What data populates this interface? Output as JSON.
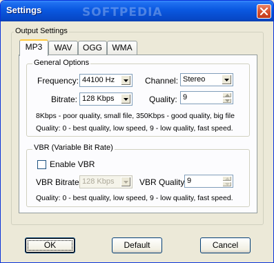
{
  "window": {
    "title": "Settings",
    "watermark": "SOFTPEDIA"
  },
  "output_settings": {
    "label": "Output Settings",
    "tabs": [
      {
        "label": "MP3",
        "active": true
      },
      {
        "label": "WAV",
        "active": false
      },
      {
        "label": "OGG",
        "active": false
      },
      {
        "label": "WMA",
        "active": false
      }
    ]
  },
  "general_options": {
    "label": "General Options",
    "frequency_label": "Frequency:",
    "frequency_value": "44100 Hz",
    "channel_label": "Channel:",
    "channel_value": "Stereo",
    "bitrate_label": "Bitrate:",
    "bitrate_value": "128 Kbps",
    "quality_label": "Quality:",
    "quality_value": "9",
    "hint_bitrate": "8Kbps - poor quality, small file, 350Kbps - good quality, big file",
    "hint_quality": "Quality: 0 - best quality, low speed, 9 - low quality, fast speed."
  },
  "vbr": {
    "label": "VBR (Variable Bit Rate)",
    "enable_label": "Enable VBR",
    "enable_checked": false,
    "bitrate_label": "VBR Bitrate:",
    "bitrate_value": "128 Kbps",
    "quality_label": "VBR Quality:",
    "quality_value": "9",
    "hint_quality": "Quality: 0 - best quality, low speed, 9 - low quality, fast speed."
  },
  "buttons": {
    "ok": "OK",
    "default": "Default",
    "cancel": "Cancel"
  }
}
